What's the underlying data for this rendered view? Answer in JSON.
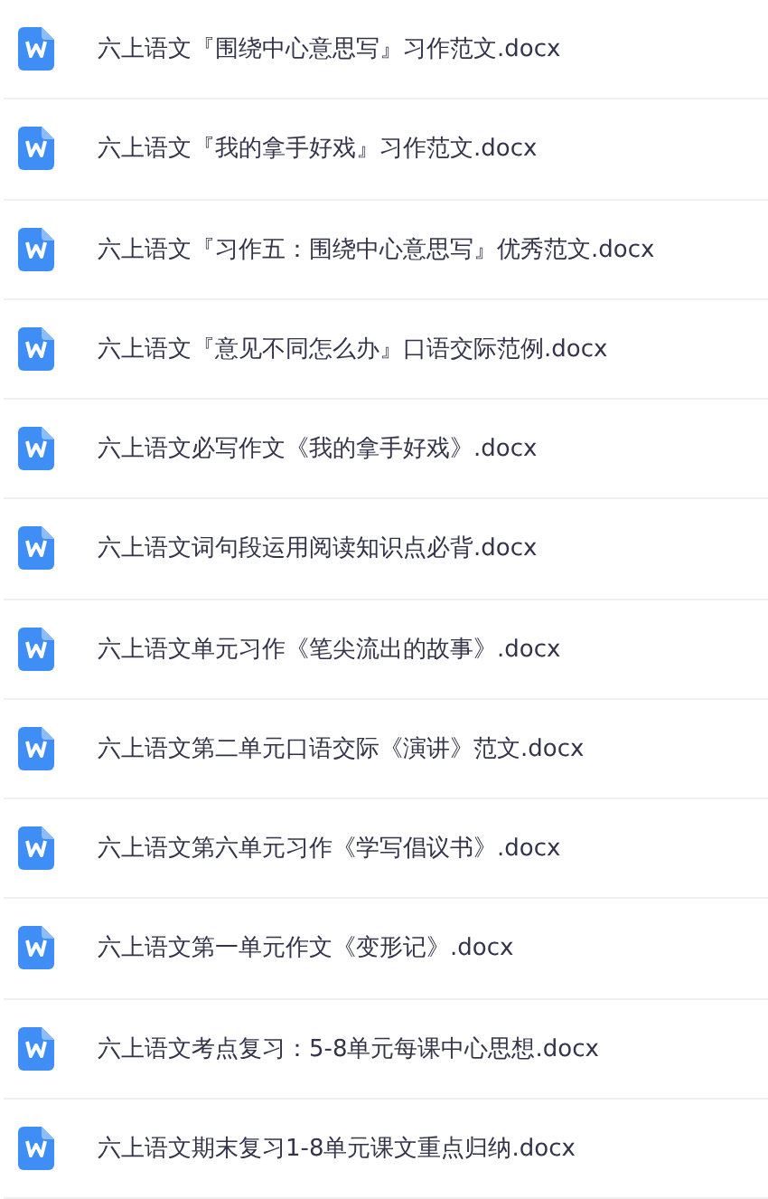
{
  "files": [
    {
      "name": "六上语文『围绕中心意思写』习作范文.docx",
      "kind": "word"
    },
    {
      "name": "六上语文『我的拿手好戏』习作范文.docx",
      "kind": "word"
    },
    {
      "name": "六上语文『习作五：围绕中心意思写』优秀范文.docx",
      "kind": "word"
    },
    {
      "name": "六上语文『意见不同怎么办』口语交际范例.docx",
      "kind": "word"
    },
    {
      "name": "六上语文必写作文《我的拿手好戏》.docx",
      "kind": "word"
    },
    {
      "name": "六上语文词句段运用阅读知识点必背.docx",
      "kind": "word"
    },
    {
      "name": "六上语文单元习作《笔尖流出的故事》.docx",
      "kind": "word"
    },
    {
      "name": "六上语文第二单元口语交际《演讲》范文.docx",
      "kind": "word"
    },
    {
      "name": "六上语文第六单元习作《学写倡议书》.docx",
      "kind": "word"
    },
    {
      "name": "六上语文第一单元作文《变形记》.docx",
      "kind": "word"
    },
    {
      "name": "六上语文考点复习：5-8单元每课中心思想.docx",
      "kind": "word"
    },
    {
      "name": "六上语文期末复习1-8单元课文重点归纳.docx",
      "kind": "word"
    }
  ]
}
